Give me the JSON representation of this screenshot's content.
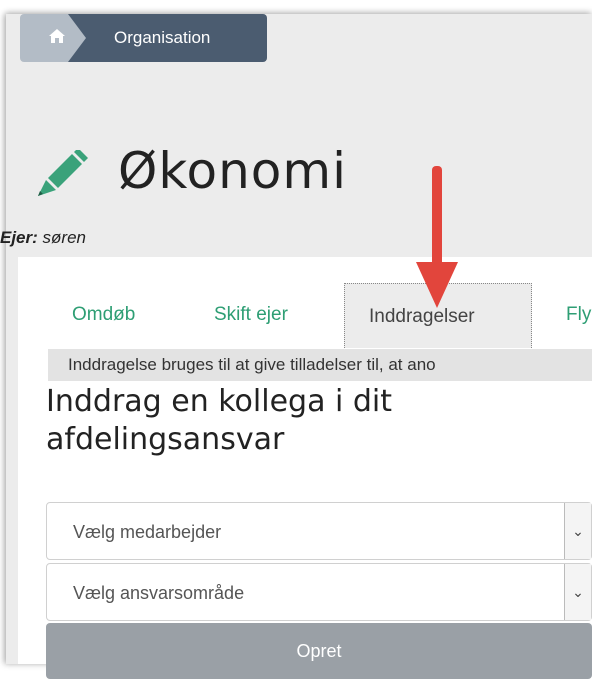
{
  "breadcrumb": {
    "home_icon": "home-icon",
    "current": "Organisation"
  },
  "header": {
    "title": "Økonomi",
    "icon": "pencil-icon",
    "owner_label": "Ejer:",
    "owner_value": "søren"
  },
  "tabs": [
    {
      "label": "Omdøb"
    },
    {
      "label": "Skift ejer"
    },
    {
      "label": "Inddragelser"
    },
    {
      "label": "Fly"
    }
  ],
  "active_tab": "Inddragelser",
  "info_text": "Inddragelse bruges til at give tilladelser til, at ano",
  "form": {
    "heading": "Inddrag en kollega i dit afdelingsansvar",
    "employee_select": "Vælg medarbejder",
    "area_select": "Vælg ansvarsområde",
    "submit_label": "Opret"
  },
  "colors": {
    "accent_green": "#2e9e74",
    "breadcrumb_dark": "#4b5c70",
    "arrow_red": "#e2453c"
  }
}
